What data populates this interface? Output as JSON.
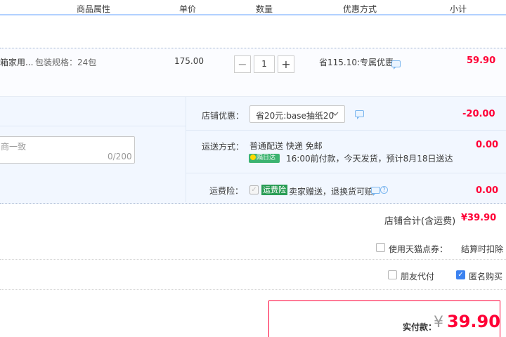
{
  "header": {
    "columns": [
      "商品属性",
      "单价",
      "数量",
      "优惠方式",
      "小计"
    ]
  },
  "item": {
    "name_truncated": "箱家用...",
    "attribute": "包装规格：24包",
    "unit_price": "175.00",
    "quantity": "1",
    "minus_symbol": "−",
    "plus_symbol": "+",
    "discount": "省115.10:专属优惠",
    "subtotal": "59.90"
  },
  "shop": {
    "message_placeholder": "商一致",
    "message_counter": "0/200",
    "coupon_label": "店铺优惠：",
    "coupon_selected": "省20元:base抽纸20",
    "coupon_amount": "-20.00",
    "shipping_label": "运送方式：",
    "shipping_method": "普通配送 快递 免邮",
    "shipping_badge": "隔日达",
    "shipping_note": "16:00前付款，今天发货，预计8月18日送达",
    "shipping_amount": "0.00",
    "insurance_label": "运费险：",
    "insurance_badge": "运费险",
    "insurance_text": "卖家赠送，退换货可赔",
    "insurance_amount": "0.00",
    "total_label": "店铺合计(含运费)",
    "total_value": "¥39.90"
  },
  "options": {
    "coupon_checkbox_label": "使用天猫点券：",
    "coupon_deduct_text": "结算时扣除",
    "friend_pay_label": "朋友代付",
    "anonymous_label": "匿名购买"
  },
  "payment": {
    "label": "实付款：",
    "currency": "¥",
    "amount": "39.90"
  },
  "colors": {
    "price_red": "#ff0036",
    "header_border": "#b2d1ff",
    "shop_bg": "#f2f7ff",
    "checkbox_blue": "#3b82f0"
  }
}
